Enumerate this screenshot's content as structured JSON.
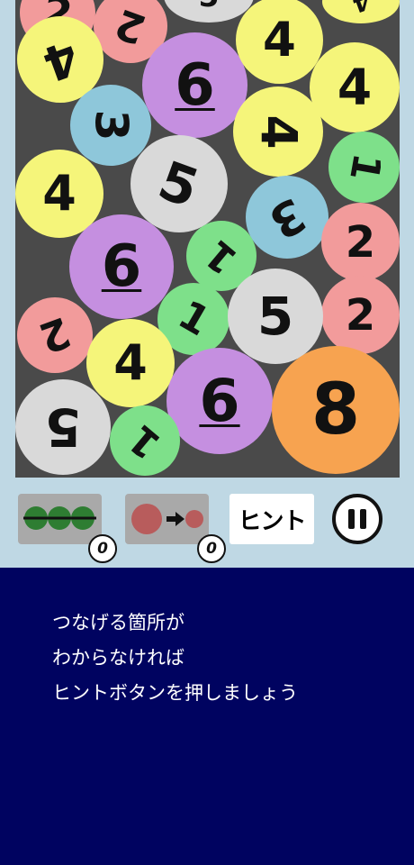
{
  "board": {
    "balls": [
      {
        "label": "2",
        "color": "#f29b9b",
        "rotation": 10
      },
      {
        "label": "5",
        "color": "#d9d9d9",
        "rotation": 0
      },
      {
        "label": "2",
        "color": "#f29b9b",
        "rotation": 200
      },
      {
        "label": "4",
        "color": "#f5f57a",
        "rotation": 160
      },
      {
        "label": "6",
        "color": "#c58fe0",
        "rotation": 0,
        "underline": true
      },
      {
        "label": "4",
        "color": "#f5f57a",
        "rotation": 0
      },
      {
        "label": "4",
        "color": "#f5f57a",
        "rotation": 0
      },
      {
        "label": "3",
        "color": "#8ec7da",
        "rotation": 90
      },
      {
        "label": "4",
        "color": "#f5f57a",
        "rotation": 90
      },
      {
        "label": "1",
        "color": "#7ee08a",
        "rotation": 100
      },
      {
        "label": "4",
        "color": "#f5f57a",
        "rotation": 0
      },
      {
        "label": "5",
        "color": "#d9d9d9",
        "rotation": 20
      },
      {
        "label": "3",
        "color": "#8ec7da",
        "rotation": 150
      },
      {
        "label": "2",
        "color": "#f29b9b",
        "rotation": 0
      },
      {
        "label": "6",
        "color": "#c58fe0",
        "rotation": 0,
        "underline": true
      },
      {
        "label": "1",
        "color": "#7ee08a",
        "rotation": 220
      },
      {
        "label": "2",
        "color": "#f29b9b",
        "rotation": 0
      },
      {
        "label": "2",
        "color": "#f29b9b",
        "rotation": 160
      },
      {
        "label": "1",
        "color": "#7ee08a",
        "rotation": 30
      },
      {
        "label": "5",
        "color": "#d9d9d9",
        "rotation": 0
      },
      {
        "label": "4",
        "color": "#f5f57a",
        "rotation": 0
      },
      {
        "label": "6",
        "color": "#c58fe0",
        "rotation": 0,
        "underline": true
      },
      {
        "label": "8",
        "color": "#f7a350",
        "rotation": 0
      },
      {
        "label": "5",
        "color": "#d9d9d9",
        "rotation": 180
      },
      {
        "label": "1",
        "color": "#7ee08a",
        "rotation": 220
      }
    ]
  },
  "items": {
    "line_item": {
      "count": "0",
      "ball_color": "#2e7d32",
      "line_color": "#111111"
    },
    "shrink_item": {
      "count": "0",
      "ball_color": "#b85c5c",
      "arrow_color": "#111111"
    }
  },
  "hint_button": {
    "label": "ヒント"
  },
  "tutorial": {
    "lines": [
      "つなげる箇所が",
      "わからなければ",
      "ヒントボタンを押しましょう"
    ]
  },
  "colors": {
    "background": "#000360",
    "panel": "#bfd8e4",
    "board": "#4a4a4a"
  }
}
